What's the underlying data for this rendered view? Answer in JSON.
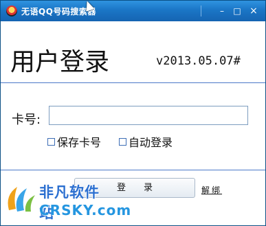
{
  "window": {
    "title": "无语QQ号码搜索器"
  },
  "controls": {
    "minimize": "–",
    "maximize": "□",
    "close": "×"
  },
  "main": {
    "heading": "用户登录",
    "version": "v2013.05.07#"
  },
  "form": {
    "card_label": "卡号:",
    "card_value": "",
    "save_label": "保存卡号",
    "auto_label": "自动登录",
    "login_label": "登录",
    "unbind_label": "解绑"
  },
  "watermark": {
    "cn": "非凡软件站",
    "en": "CRSKY.com"
  },
  "colors": {
    "titlebar": "#1b76c6",
    "border": "#0b4f85",
    "rule": "#4a78c8"
  }
}
